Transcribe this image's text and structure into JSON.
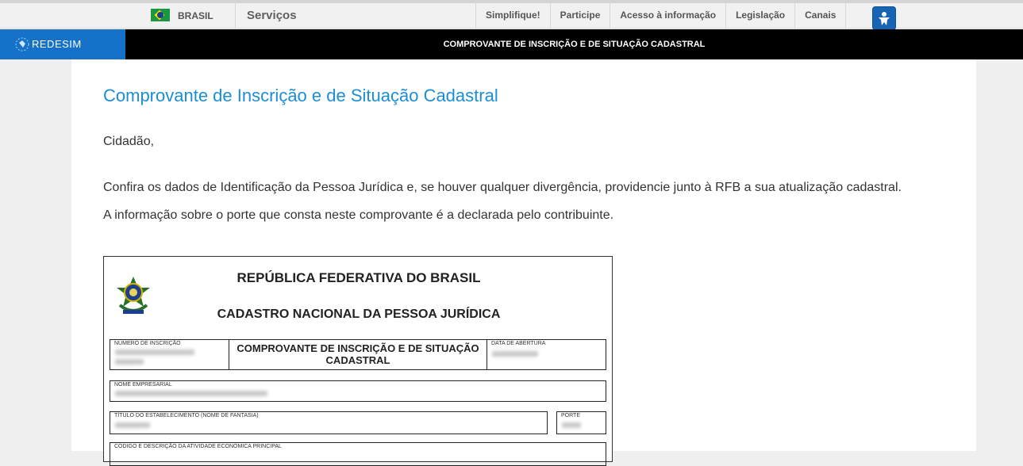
{
  "gov_bar": {
    "country": "BRASIL",
    "services": "Serviços",
    "links": [
      "Simplifique!",
      "Participe",
      "Acesso à informação",
      "Legislação",
      "Canais"
    ]
  },
  "header": {
    "logo_text": "REDESIM",
    "title": "COMPROVANTE DE INSCRIÇÃO E DE SITUAÇÃO CADASTRAL"
  },
  "main": {
    "title": "Comprovante de Inscrição e de Situação Cadastral",
    "greeting": "Cidadão,",
    "paragraph1": "Confira os dados de Identificação da Pessoa Jurídica e, se houver qualquer divergência, providencie junto à RFB a sua atualização cadastral.",
    "paragraph2": "A informação sobre o porte que consta neste comprovante é a declarada pelo contribuinte."
  },
  "document": {
    "heading1": "REPÚBLICA FEDERATIVA DO BRASIL",
    "heading2": "CADASTRO NACIONAL DA PESSOA JURÍDICA",
    "numero_label": "NÚMERO DE INSCRIÇÃO",
    "comprovante_title": "COMPROVANTE DE INSCRIÇÃO E DE SITUAÇÃO CADASTRAL",
    "data_label": "DATA DE ABERTURA",
    "nome_label": "NOME EMPRESARIAL",
    "titulo_label": "TÍTULO DO ESTABELECIMENTO (NOME DE FANTASIA)",
    "porte_label": "PORTE",
    "atividade_label": "CÓDIGO E DESCRIÇÃO DA ATIVIDADE ECONÔMICA PRINCIPAL"
  }
}
